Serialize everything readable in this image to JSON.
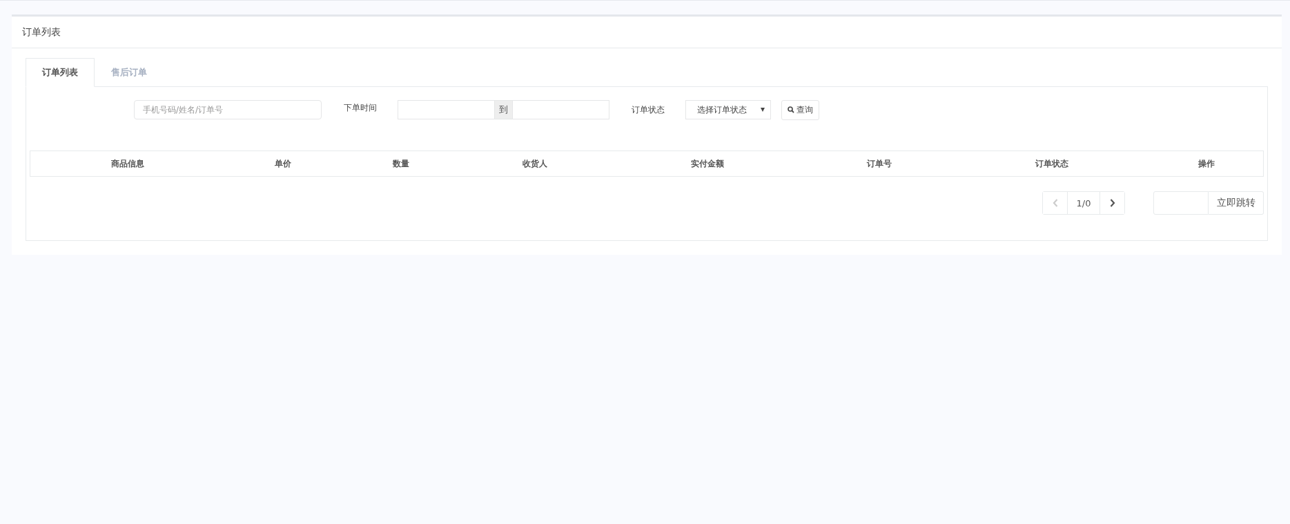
{
  "panel": {
    "title": "订单列表"
  },
  "tabs": [
    {
      "label": "订单列表",
      "selected": true
    },
    {
      "label": "售后订单",
      "selected": false
    }
  ],
  "filters": {
    "search": {
      "placeholder": "手机号码/姓名/订单号"
    },
    "time_label": "下单时间",
    "range_separator": "到",
    "status_label": "订单状态",
    "status_select": {
      "value": "选择订单状态"
    },
    "query_button": "查询"
  },
  "table": {
    "columns": [
      "商品信息",
      "单价",
      "数量",
      "收货人",
      "实付金额",
      "订单号",
      "订单状态",
      "操作"
    ]
  },
  "pagination": {
    "prev": {
      "disabled": true
    },
    "page": "1/0",
    "next": {
      "disabled": false
    },
    "jump_button": "立即跳转"
  }
}
